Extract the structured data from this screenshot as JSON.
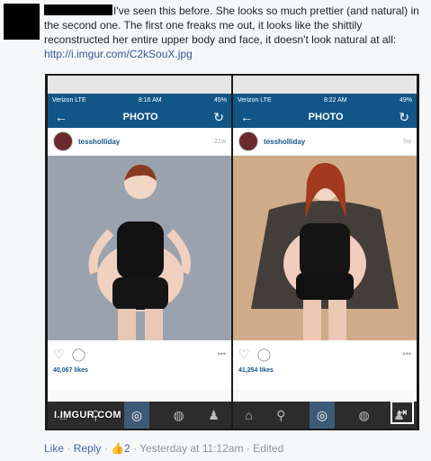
{
  "comment": {
    "text": "I've seen this before. She looks so much prettier (and natural) in the second one. The first one freaks me out, it looks like the shittily reconstructed her entire upper body and face, it doesn't look natural at all:",
    "link": "http://i.imgur.com/C2kSouX.jpg"
  },
  "left_phone": {
    "carrier": "Verizon LTE",
    "time": "8:16 AM",
    "battery": "45%",
    "title": "PHOTO",
    "username": "tessholliday",
    "post_age": "21w",
    "likes": "40,067 likes"
  },
  "right_phone": {
    "carrier": "Verizon LTE",
    "time": "8:22 AM",
    "battery": "49%",
    "title": "PHOTO",
    "username": "tessholliday",
    "post_age": "5w",
    "likes": "41,254 likes"
  },
  "watermark": "I.IMGUR.COM",
  "footer": {
    "like": "Like",
    "reply": "Reply",
    "reactions": "2",
    "timestamp": "Yesterday at 11:12am",
    "edited": "Edited"
  }
}
